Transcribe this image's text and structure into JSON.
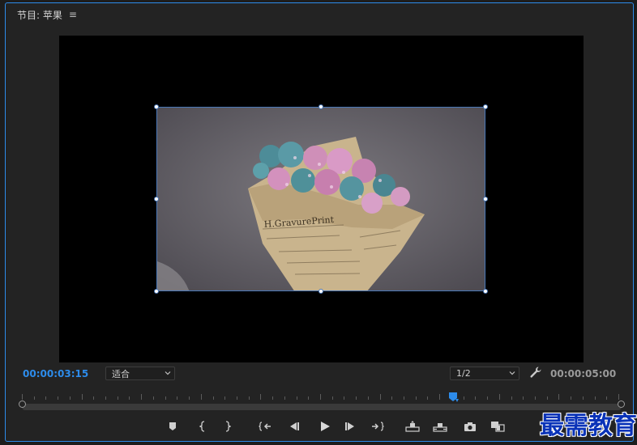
{
  "panel": {
    "title": "节目: 苹果"
  },
  "timecodes": {
    "current": "00:00:03:15",
    "duration": "00:00:05:00"
  },
  "zoom_select": {
    "value": "适合"
  },
  "resolution_select": {
    "value": "1/2"
  },
  "playhead": {
    "position_fraction": 0.72
  },
  "colors": {
    "accent": "#2d8ceb",
    "panel_bg": "#232323",
    "monitor_bg": "#000000"
  },
  "controls": [
    {
      "name": "add-marker-button",
      "icon": "marker-icon"
    },
    {
      "name": "mark-in-button",
      "icon": "mark-in-icon"
    },
    {
      "name": "mark-out-button",
      "icon": "mark-out-icon"
    },
    {
      "name": "go-to-in-button",
      "icon": "go-to-in-icon"
    },
    {
      "name": "step-back-button",
      "icon": "step-back-icon"
    },
    {
      "name": "play-button",
      "icon": "play-icon"
    },
    {
      "name": "step-forward-button",
      "icon": "step-forward-icon"
    },
    {
      "name": "go-to-out-button",
      "icon": "go-to-out-icon"
    },
    {
      "name": "lift-button",
      "icon": "lift-icon"
    },
    {
      "name": "extract-button",
      "icon": "extract-icon"
    },
    {
      "name": "export-frame-button",
      "icon": "camera-icon"
    },
    {
      "name": "comparison-view-button",
      "icon": "comparison-view-icon"
    }
  ],
  "watermark": {
    "text": "最需教育"
  }
}
